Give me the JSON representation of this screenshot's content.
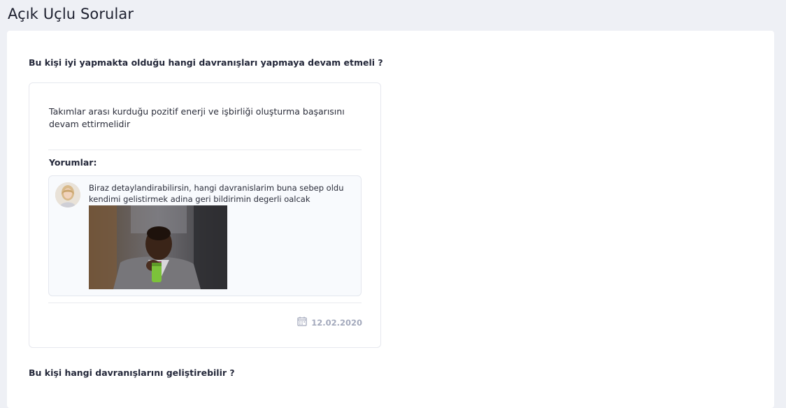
{
  "page": {
    "title": "Açık Uçlu Sorular"
  },
  "questions": [
    {
      "text": "Bu kişi iyi yapmakta olduğu hangi davranışları yapmaya devam etmeli ?",
      "answer": {
        "text": "Takımlar arası kurduğu pozitif enerji ve işbirliği oluşturma başarısını devam ettirmelidir",
        "comments_label": "Yorumlar:",
        "comments": [
          {
            "text": "Biraz detaylandirabilirsin, hangi davranislarim buna sebep oldu kendimi gelistirmek adina geri bildirimin degerli oalcak",
            "has_image": true
          }
        ],
        "date": "12.02.2020",
        "date_icon": "calendar-icon"
      }
    },
    {
      "text": "Bu kişi hangi davranışlarını geliştirebilir ?"
    }
  ],
  "colors": {
    "background": "#eef0f5",
    "card_border": "#e6e8ee",
    "comment_bg": "#f8fafd",
    "date_color": "#a3a9bc"
  }
}
